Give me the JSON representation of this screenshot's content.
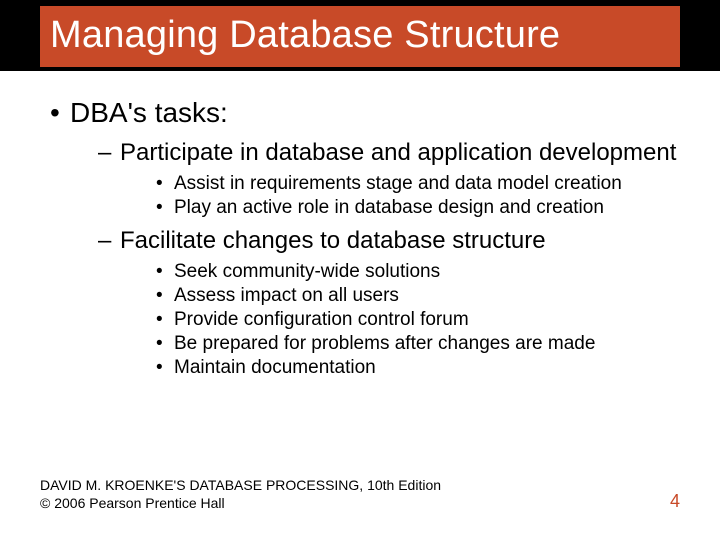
{
  "title": "Managing Database Structure",
  "bullets": {
    "l1_0": "DBA's tasks:",
    "l2_0": "Participate in database and application development",
    "l3_0_0": "Assist in requirements stage and data model creation",
    "l3_0_1": "Play an active role in database design and creation",
    "l2_1": "Facilitate changes to database structure",
    "l3_1_0": "Seek community-wide solutions",
    "l3_1_1": "Assess impact on all users",
    "l3_1_2": "Provide configuration control forum",
    "l3_1_3": "Be prepared for problems after changes are made",
    "l3_1_4": "Maintain documentation"
  },
  "footer": {
    "line1": "DAVID M. KROENKE'S DATABASE PROCESSING, 10th Edition",
    "line2": "© 2006 Pearson Prentice Hall",
    "page": "4"
  }
}
